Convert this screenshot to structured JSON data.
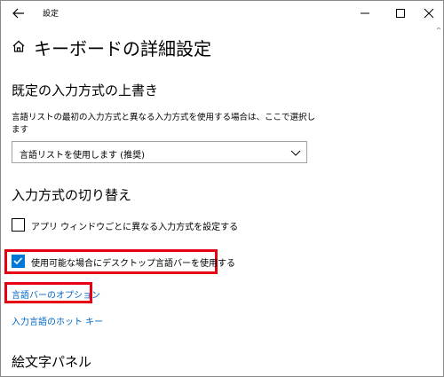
{
  "window": {
    "title": "設定",
    "back_icon": "arrow-left-icon",
    "minimize_icon": "minimize-icon",
    "maximize_icon": "maximize-icon",
    "close_icon": "close-icon"
  },
  "header": {
    "home_icon": "home-icon",
    "title": "キーボードの詳細設定"
  },
  "override_section": {
    "title": "既定の入力方式の上書き",
    "description": "言語リストの最初の入力方式と異なる入力方式を使用する場合は、ここで選択します",
    "dropdown": {
      "selected": "言語リストを使用します (推奨)",
      "chevron_icon": "chevron-down-icon"
    }
  },
  "switch_section": {
    "title": "入力方式の切り替え",
    "checkbox_per_app": {
      "label": "アプリ ウィンドウごとに異なる入力方式を設定する",
      "checked": false
    },
    "checkbox_language_bar": {
      "label": "使用可能な場合にデスクトップ言語バーを使用する",
      "checked": true
    },
    "link_language_bar_options": "言語バーのオプション",
    "link_hotkeys": "入力言語のホット キー"
  },
  "emoji_section": {
    "title": "絵文字パネル"
  },
  "colors": {
    "accent": "#0078d7",
    "link": "#0067c0",
    "highlight": "#e60012"
  }
}
